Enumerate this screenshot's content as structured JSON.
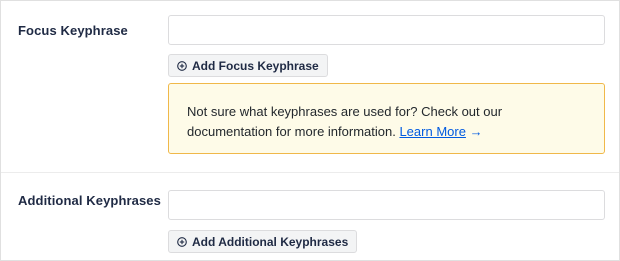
{
  "focus": {
    "label": "Focus Keyphrase",
    "input_value": "",
    "add_button_label": "Add Focus Keyphrase"
  },
  "notice": {
    "text": "Not sure what keyphrases are used for? Check out our documentation for more information.",
    "link_label": "Learn More",
    "arrow": "→"
  },
  "additional": {
    "label": "Additional Keyphrases",
    "input_value": "",
    "add_button_label": "Add Additional Keyphrases"
  },
  "icons": {
    "add": "plus-circle-icon"
  },
  "colors": {
    "notice_border": "#f0b849",
    "notice_background": "#fefbe8",
    "link": "#005ae0",
    "label_text": "#1f2a44"
  }
}
